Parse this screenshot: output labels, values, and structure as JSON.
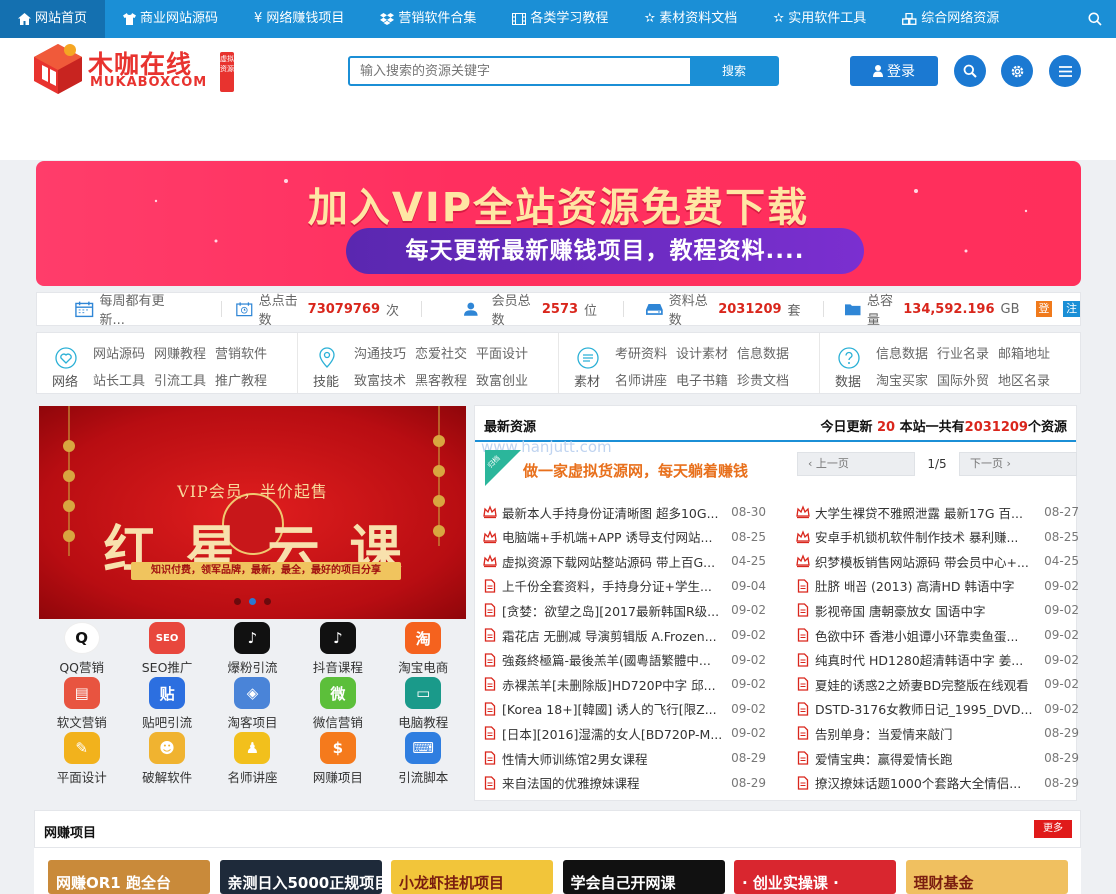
{
  "nav": {
    "items": [
      {
        "label": "网站首页",
        "icon": "home-icon"
      },
      {
        "label": "商业网站源码",
        "icon": "shirt-icon"
      },
      {
        "label": "网络赚钱项目",
        "icon": "yen-icon"
      },
      {
        "label": "营销软件合集",
        "icon": "dropbox-icon"
      },
      {
        "label": "各类学习教程",
        "icon": "film-icon"
      },
      {
        "label": "素材资料文档",
        "icon": "star-icon"
      },
      {
        "label": "实用软件工具",
        "icon": "star-icon"
      },
      {
        "label": "综合网络资源",
        "icon": "cubes-icon"
      }
    ]
  },
  "header": {
    "logo_cn": "木咖在线",
    "logo_en": "MUKABOXCOM",
    "logo_seal": "虚拟资源",
    "search_placeholder": "输入搜索的资源关键字",
    "search_button": "搜索",
    "login_label": "登录"
  },
  "banner": {
    "headline": "加入VIP全站资源免费下载",
    "subline": "每天更新最新赚钱项目，教程资料...."
  },
  "stats": {
    "update_text": "每周都有更新...",
    "clicks_label": "总点击数",
    "clicks_value": "73079769",
    "clicks_unit": "次",
    "members_label": "会员总数",
    "members_value": "2573",
    "members_unit": "位",
    "resources_label": "资料总数",
    "resources_value": "2031209",
    "resources_unit": "套",
    "capacity_label": "总容量",
    "capacity_value": "134,592.196",
    "capacity_unit": "GB",
    "tag1": "登",
    "tag2": "注",
    "colors": {
      "tag1": "#f07a1c",
      "tag2": "#1b8fd6"
    }
  },
  "categories": [
    {
      "label": "网络",
      "links": [
        "网站源码",
        "网赚教程",
        "营销软件",
        "站长工具",
        "引流工具",
        "推广教程"
      ]
    },
    {
      "label": "技能",
      "links": [
        "沟通技巧",
        "恋爱社交",
        "平面设计",
        "致富技术",
        "黑客教程",
        "致富创业"
      ]
    },
    {
      "label": "素材",
      "links": [
        "考研资料",
        "设计素材",
        "信息数据",
        "名师讲座",
        "电子书籍",
        "珍贵文档"
      ]
    },
    {
      "label": "数据",
      "links": [
        "信息数据",
        "行业名录",
        "邮箱地址",
        "淘宝买家",
        "国际外贸",
        "地区名录"
      ]
    }
  ],
  "slider": {
    "subtitle": "VIP会员，半价起售",
    "title": "红星云课",
    "strip": "知识付费，领军品牌，最新，最全，最好的项目分享"
  },
  "apps": [
    {
      "label": "QQ营销",
      "glyph": "Q",
      "color": "#ffffff"
    },
    {
      "label": "SEO推广",
      "glyph": "SEO",
      "color": "#e8473d"
    },
    {
      "label": "爆粉引流",
      "glyph": "♪",
      "color": "#111111"
    },
    {
      "label": "抖音课程",
      "glyph": "♪",
      "color": "#111111"
    },
    {
      "label": "淘宝电商",
      "glyph": "淘",
      "color": "#f5621e"
    },
    {
      "label": "软文营销",
      "glyph": "▤",
      "color": "#e85440"
    },
    {
      "label": "贴吧引流",
      "glyph": "贴",
      "color": "#2c6fe0"
    },
    {
      "label": "淘客项目",
      "glyph": "◈",
      "color": "#4a84d8"
    },
    {
      "label": "微信营销",
      "glyph": "微",
      "color": "#5cbf3a"
    },
    {
      "label": "电脑教程",
      "glyph": "▭",
      "color": "#1a9a8a"
    },
    {
      "label": "平面设计",
      "glyph": "✎",
      "color": "#f2b21c"
    },
    {
      "label": "破解软件",
      "glyph": "☻",
      "color": "#f0b330"
    },
    {
      "label": "名师讲座",
      "glyph": "♟",
      "color": "#f2c01c"
    },
    {
      "label": "网赚项目",
      "glyph": "$",
      "color": "#f57a1c"
    },
    {
      "label": "引流脚本",
      "glyph": "⌨",
      "color": "#2f7ee0"
    }
  ],
  "latest": {
    "title": "最新资源",
    "today_label": "今日更新",
    "today_value": "20",
    "total_label": "本站一共有",
    "total_value": "2031209",
    "total_unit": "个资源",
    "watermark": "www.hanjutt.com",
    "promo_corner": "归档",
    "promo_text": "做一家虚拟货源网，每天躺着赚钱",
    "prev_label": "上一页",
    "next_label": "下一页",
    "page_text": "1/5",
    "left_items": [
      {
        "title": "最新本人手持身份证清晰图 超多10G...",
        "date": "08-30",
        "hot": true
      },
      {
        "title": "电脑端+手机端+APP 诱导支付网站...",
        "date": "08-25",
        "hot": true
      },
      {
        "title": "虚拟资源下载网站整站源码 带上百G...",
        "date": "04-25",
        "hot": true
      },
      {
        "title": "上千份全套资料，手持身分证+学生...",
        "date": "09-04",
        "hot": false
      },
      {
        "title": "[贪婪：欲望之岛][2017最新韩国R级...",
        "date": "09-02",
        "hot": false
      },
      {
        "title": "霜花店 无删减 导演剪辑版 A.Frozen...",
        "date": "09-02",
        "hot": false
      },
      {
        "title": "強姦終極篇-最後羔羊(國粵語繁體中...",
        "date": "09-02",
        "hot": false
      },
      {
        "title": "赤裸羔羊[未删除版]HD720P中字 邱...",
        "date": "09-02",
        "hot": false
      },
      {
        "title": "[Korea 18+][韓國] 诱人的飞行[限Z...",
        "date": "09-02",
        "hot": false
      },
      {
        "title": "[日本][2016]湿濡的女人[BD720P-M...",
        "date": "09-02",
        "hot": false
      },
      {
        "title": "性情大师训练馆2男女课程",
        "date": "08-29",
        "hot": false
      },
      {
        "title": "来自法国的优雅撩妹课程",
        "date": "08-29",
        "hot": false
      }
    ],
    "right_items": [
      {
        "title": "大学生裸贷不雅照泄露 最新17G 百...",
        "date": "08-27",
        "hot": true
      },
      {
        "title": "安卓手机锁机软件制作技术 暴利赚...",
        "date": "08-25",
        "hot": true
      },
      {
        "title": "织梦模板销售网站源码 带会员中心+...",
        "date": "04-25",
        "hot": true
      },
      {
        "title": "肚脐 배꼽 (2013) 高清HD 韩语中字",
        "date": "09-02",
        "hot": false
      },
      {
        "title": "影视帝国 唐朝豪放女 国语中字",
        "date": "09-02",
        "hot": false
      },
      {
        "title": "色欲中环 香港小姐谭小环靠卖鱼蛋...",
        "date": "09-02",
        "hot": false
      },
      {
        "title": "纯真时代 HD1280超清韩语中字 姜...",
        "date": "09-02",
        "hot": false
      },
      {
        "title": "夏娃的诱惑2之娇妻BD完整版在线观看",
        "date": "09-02",
        "hot": false
      },
      {
        "title": "DSTD-3176女教师日记_1995_DVD...",
        "date": "09-02",
        "hot": false
      },
      {
        "title": "告别单身：当爱情来敲门",
        "date": "08-29",
        "hot": false
      },
      {
        "title": "爱情宝典：赢得爱情长跑",
        "date": "08-29",
        "hot": false
      },
      {
        "title": "撩汉撩妹话题1000个套路大全情侣...",
        "date": "08-29",
        "hot": false
      }
    ]
  },
  "section": {
    "title": "网赚项目",
    "more_label": "更多",
    "thumbs": [
      {
        "text": "网赚OR1 跑全台",
        "color": "#c98a3a"
      },
      {
        "text": "亲测日入5000正规项目",
        "color": "#1e2a3a"
      },
      {
        "text": "小龙虾挂机项目",
        "color": "#f2c53a"
      },
      {
        "text": "学会自己开网课",
        "color": "#111111"
      },
      {
        "text": "· 创业实操课 ·",
        "color": "#d9262f"
      },
      {
        "text": "理财基金",
        "color": "#f0c060"
      }
    ]
  }
}
